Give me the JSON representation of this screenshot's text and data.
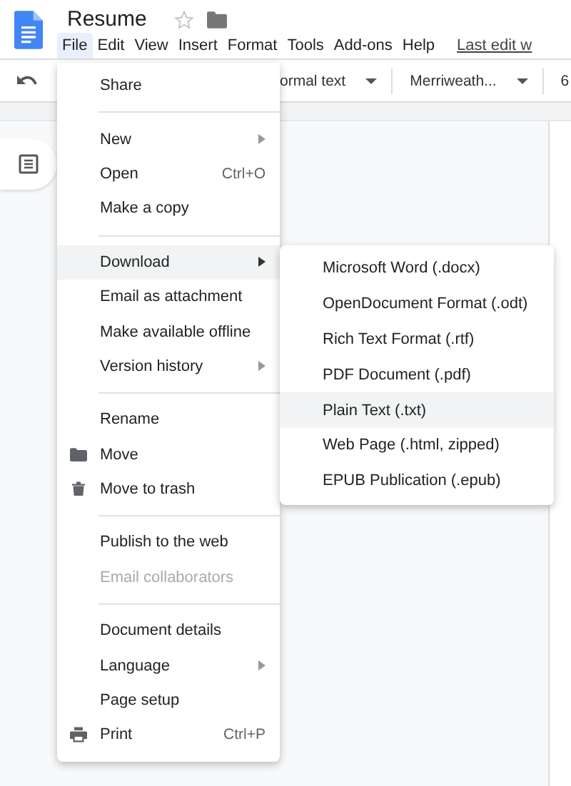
{
  "document": {
    "title": "Resume"
  },
  "menubar": [
    {
      "label": "File",
      "selected": true
    },
    {
      "label": "Edit",
      "selected": false
    },
    {
      "label": "View",
      "selected": false
    },
    {
      "label": "Insert",
      "selected": false
    },
    {
      "label": "Format",
      "selected": false
    },
    {
      "label": "Tools",
      "selected": false
    },
    {
      "label": "Add-ons",
      "selected": false
    },
    {
      "label": "Help",
      "selected": false
    }
  ],
  "last_edit_link": "Last edit w",
  "toolbar": {
    "style": "ormal text",
    "font": "Merriweath...",
    "size": "6"
  },
  "file_menu": [
    {
      "kind": "item",
      "label": "Share",
      "selected": false,
      "disabled": false
    },
    {
      "kind": "divider"
    },
    {
      "kind": "item",
      "label": "New",
      "submenu": true,
      "selected": false,
      "disabled": false
    },
    {
      "kind": "item",
      "label": "Open",
      "shortcut": "Ctrl+O",
      "selected": false,
      "disabled": false
    },
    {
      "kind": "item",
      "label": "Make a copy",
      "selected": false,
      "disabled": false
    },
    {
      "kind": "divider"
    },
    {
      "kind": "item",
      "label": "Download",
      "submenu": true,
      "selected": true,
      "disabled": false
    },
    {
      "kind": "item",
      "label": "Email as attachment",
      "selected": false,
      "disabled": false
    },
    {
      "kind": "item",
      "label": "Make available offline",
      "selected": false,
      "disabled": false
    },
    {
      "kind": "item",
      "label": "Version history",
      "submenu": true,
      "selected": false,
      "disabled": false
    },
    {
      "kind": "divider"
    },
    {
      "kind": "item",
      "label": "Rename",
      "selected": false,
      "disabled": false
    },
    {
      "kind": "folder",
      "label": "Move",
      "selected": false,
      "disabled": false
    },
    {
      "kind": "trash",
      "label": "Move to trash",
      "selected": false,
      "disabled": false
    },
    {
      "kind": "divider"
    },
    {
      "kind": "item",
      "label": "Publish to the web",
      "selected": false,
      "disabled": false
    },
    {
      "kind": "item",
      "label": "Email collaborators",
      "selected": false,
      "disabled": true
    },
    {
      "kind": "divider"
    },
    {
      "kind": "item",
      "label": "Document details",
      "selected": false,
      "disabled": false
    },
    {
      "kind": "item",
      "label": "Language",
      "submenu": true,
      "selected": false,
      "disabled": false
    },
    {
      "kind": "item",
      "label": "Page setup",
      "selected": false,
      "disabled": false
    },
    {
      "kind": "printer",
      "label": "Print",
      "shortcut": "Ctrl+P",
      "selected": false,
      "disabled": false
    }
  ],
  "download_submenu": [
    {
      "label": "Microsoft Word (.docx)",
      "selected": false
    },
    {
      "label": "OpenDocument Format (.odt)",
      "selected": false
    },
    {
      "label": "Rich Text Format (.rtf)",
      "selected": false
    },
    {
      "label": "PDF Document (.pdf)",
      "selected": false
    },
    {
      "label": "Plain Text (.txt)",
      "selected": true
    },
    {
      "label": "Web Page (.html, zipped)",
      "selected": false
    },
    {
      "label": "EPUB Publication (.epub)",
      "selected": false
    }
  ]
}
